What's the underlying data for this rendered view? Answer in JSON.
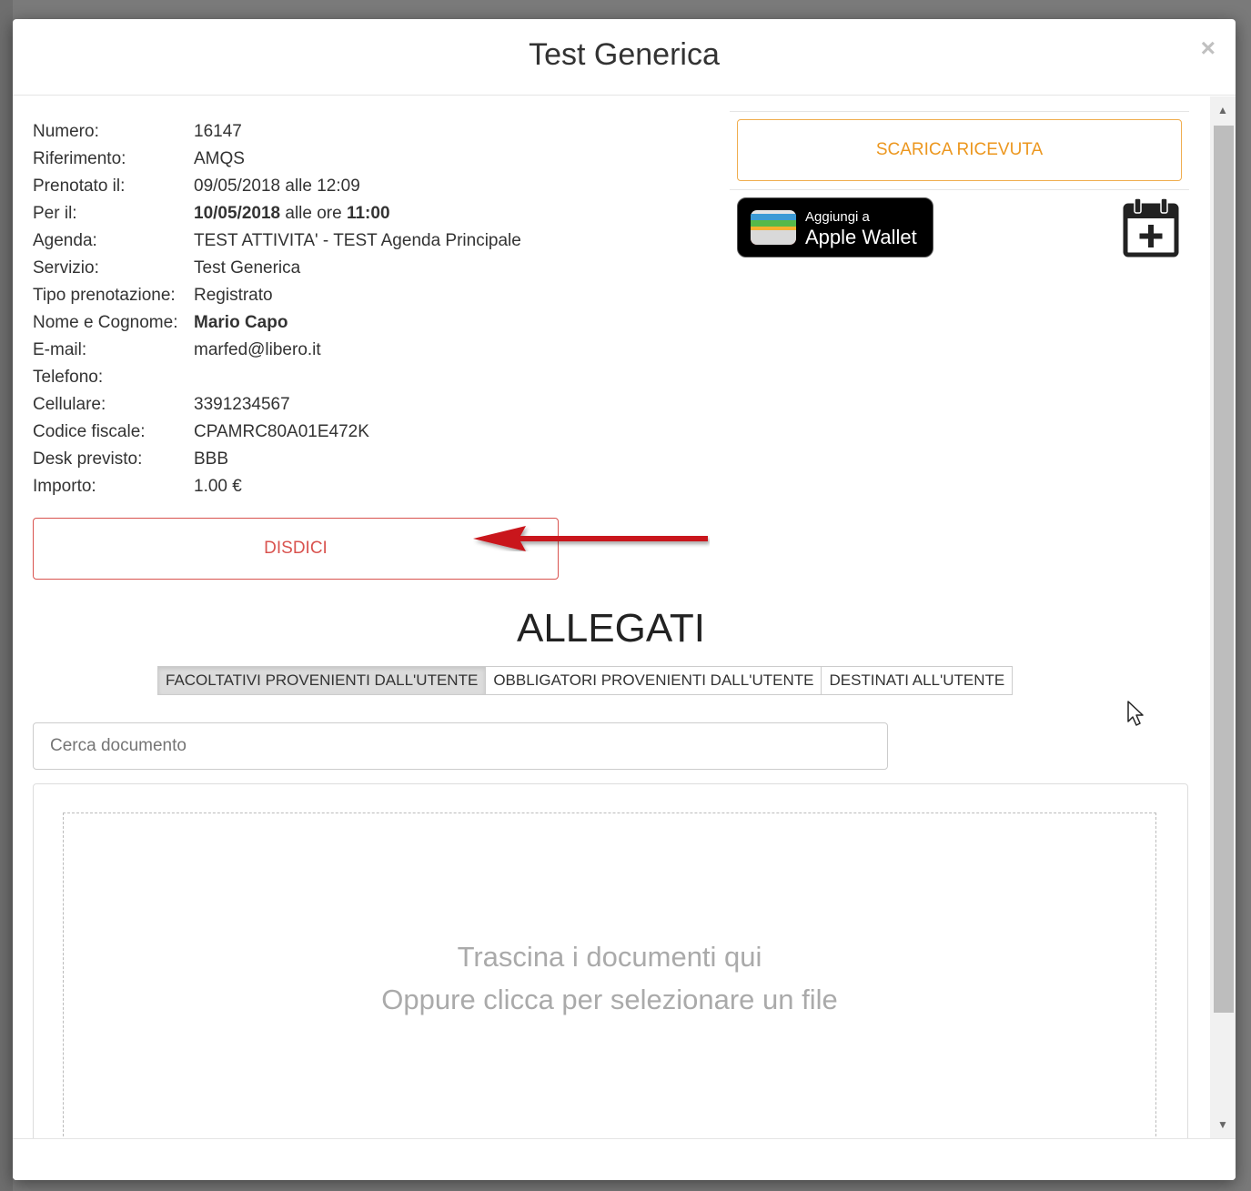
{
  "modal": {
    "title": "Test Generica",
    "close_label": "×"
  },
  "booking": {
    "rows": [
      {
        "label": "Numero:",
        "value": "16147"
      },
      {
        "label": "Riferimento:",
        "value": "AMQS"
      },
      {
        "label": "Prenotato il:",
        "value": "09/05/2018 alle 12:09"
      },
      {
        "label": "Per il:",
        "value_date": "10/05/2018",
        "value_mid": " alle ore ",
        "value_time": "11:00"
      },
      {
        "label": "Agenda:",
        "value": "TEST ATTIVITA' - TEST Agenda Principale"
      },
      {
        "label": "Servizio:",
        "value": "Test Generica"
      },
      {
        "label": "Tipo prenotazione:",
        "value": "Registrato"
      },
      {
        "label": "Nome e Cognome:",
        "value": "Mario Capo"
      },
      {
        "label": "E-mail:",
        "value": "marfed@libero.it"
      },
      {
        "label": "Telefono:",
        "value": ""
      },
      {
        "label": "Cellulare:",
        "value": "3391234567"
      },
      {
        "label": "Codice fiscale:",
        "value": "CPAMRC80A01E472K"
      },
      {
        "label": "Desk previsto:",
        "value": "BBB"
      },
      {
        "label": "Importo:",
        "value": "1.00 €"
      }
    ]
  },
  "actions": {
    "disdici_label": "DISDICI",
    "ricevuta_label": "SCARICA RICEVUTA",
    "wallet_small": "Aggiungi a",
    "wallet_big": "Apple Wallet"
  },
  "allegati": {
    "title": "ALLEGATI",
    "tabs": [
      {
        "label": "FACOLTATIVI PROVENIENTI DALL'UTENTE",
        "active": true
      },
      {
        "label": "OBBLIGATORI PROVENIENTI DALL'UTENTE",
        "active": false
      },
      {
        "label": "DESTINATI ALL'UTENTE",
        "active": false
      }
    ],
    "search_placeholder": "Cerca documento",
    "drop_line1": "Trascina i documenti qui",
    "drop_line2": "Oppure clicca per selezionare un file"
  },
  "colors": {
    "danger": "#d9534f",
    "warning": "#ec971f",
    "annotation_arrow": "#c9151b"
  },
  "icons": [
    "close-icon",
    "apple-wallet-icon",
    "calendar-add-icon",
    "arrow-annotation",
    "mouse-cursor-icon",
    "scroll-up-icon",
    "scroll-down-icon"
  ]
}
